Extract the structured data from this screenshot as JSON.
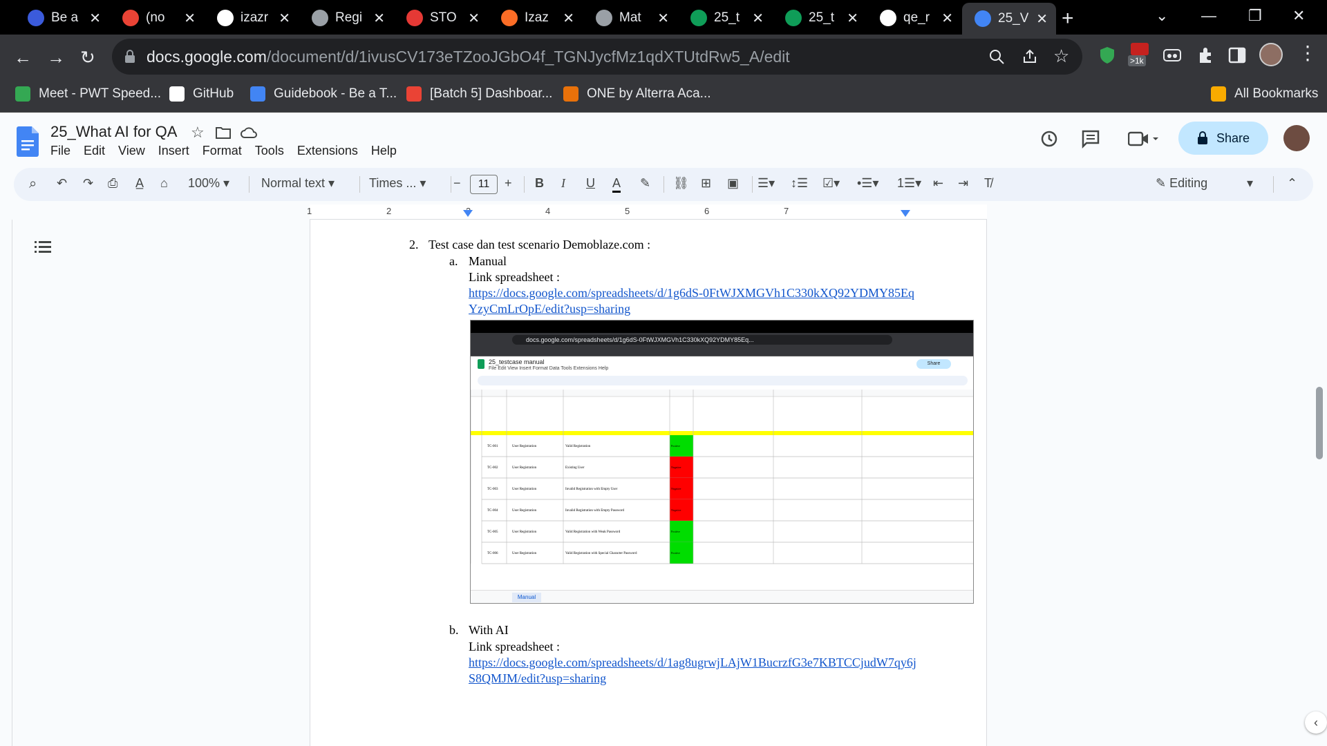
{
  "tabs": [
    {
      "title": "Be a",
      "color": "#3b5bdb"
    },
    {
      "title": "(no",
      "color": "#ea4335"
    },
    {
      "title": "izazr",
      "color": "#ffffff"
    },
    {
      "title": "Regi",
      "color": "#9aa0a6"
    },
    {
      "title": "STO",
      "color": "#e53935"
    },
    {
      "title": "Izaz",
      "color": "#fc6d26"
    },
    {
      "title": "Mat",
      "color": "#9aa0a6"
    },
    {
      "title": "25_t",
      "color": "#0f9d58"
    },
    {
      "title": "25_t",
      "color": "#0f9d58"
    },
    {
      "title": "qe_r",
      "color": "#ffffff"
    },
    {
      "title": "25_V",
      "color": "#4285f4"
    }
  ],
  "address": {
    "domain": "docs.google.com",
    "path": "/document/d/1ivusCV173eTZooJGbO4f_TGNJycfMz1qdXTUtdRw5_A/edit"
  },
  "ext_badge": ">1k",
  "bookmarks": [
    "Meet - PWT Speed...",
    "GitHub",
    "Guidebook - Be a T...",
    "[Batch 5] Dashboar...",
    "ONE by Alterra Aca..."
  ],
  "all_bookmarks": "All Bookmarks",
  "doc": {
    "title": "25_What AI for QA",
    "menus": [
      "File",
      "Edit",
      "View",
      "Insert",
      "Format",
      "Tools",
      "Extensions",
      "Help"
    ],
    "share": "Share",
    "mode": "Editing"
  },
  "toolbar": {
    "zoom": "100%",
    "style": "Normal text",
    "font": "Times ...",
    "size": "11"
  },
  "ruler": [
    "1",
    "2",
    "3",
    "4",
    "5",
    "6",
    "7"
  ],
  "content": {
    "item2": "2.",
    "item2_text": "Test case dan test scenario Demoblaze.com :",
    "a": "a.",
    "a_text": "Manual",
    "a_label": "Link spreadsheet :",
    "a_link1": "https://docs.google.com/spreadsheets/d/1g6dS-0FtWJXMGVh1C330kXQ92YDMY85Eq",
    "a_link2": "YzyCmLrOpE/edit?usp=sharing",
    "b": "b.",
    "b_text": "With AI",
    "b_label": "Link spreadsheet :",
    "b_link1": "https://docs.google.com/spreadsheets/d/1ag8ugrwjLAjW1BucrzfG3e7KBTCCjudW7qy6j",
    "b_link2": "S8QMJM/edit?usp=sharing"
  },
  "embedded": {
    "url": "docs.google.com/spreadsheets/d/1g6dS-0FtWJXMGVh1C330kXQ92YDMY85Eq...",
    "sheet_title": "25_testcase manual",
    "sheet_tab": "Manual",
    "rows": [
      {
        "id": "TC-001",
        "scenario": "User Registration",
        "title": "Valid Registration",
        "type": "Positive",
        "color": "#00dd00"
      },
      {
        "id": "TC-002",
        "scenario": "User Registration",
        "title": "Existing User",
        "type": "Negative",
        "color": "#ff0000"
      },
      {
        "id": "TC-003",
        "scenario": "User Registration",
        "title": "Invalid Registration with Empty User",
        "type": "Negative",
        "color": "#ff0000"
      },
      {
        "id": "TC-004",
        "scenario": "User Registration",
        "title": "Invalid Registration with Empty Password",
        "type": "Negative",
        "color": "#ff0000"
      },
      {
        "id": "TC-005",
        "scenario": "User Registration",
        "title": "Valid Registration with Weak Password",
        "type": "Positive",
        "color": "#00dd00"
      },
      {
        "id": "TC-006",
        "scenario": "User Registration",
        "title": "Valid Registration with Special Character Password",
        "type": "Positive",
        "color": "#00dd00"
      }
    ]
  }
}
